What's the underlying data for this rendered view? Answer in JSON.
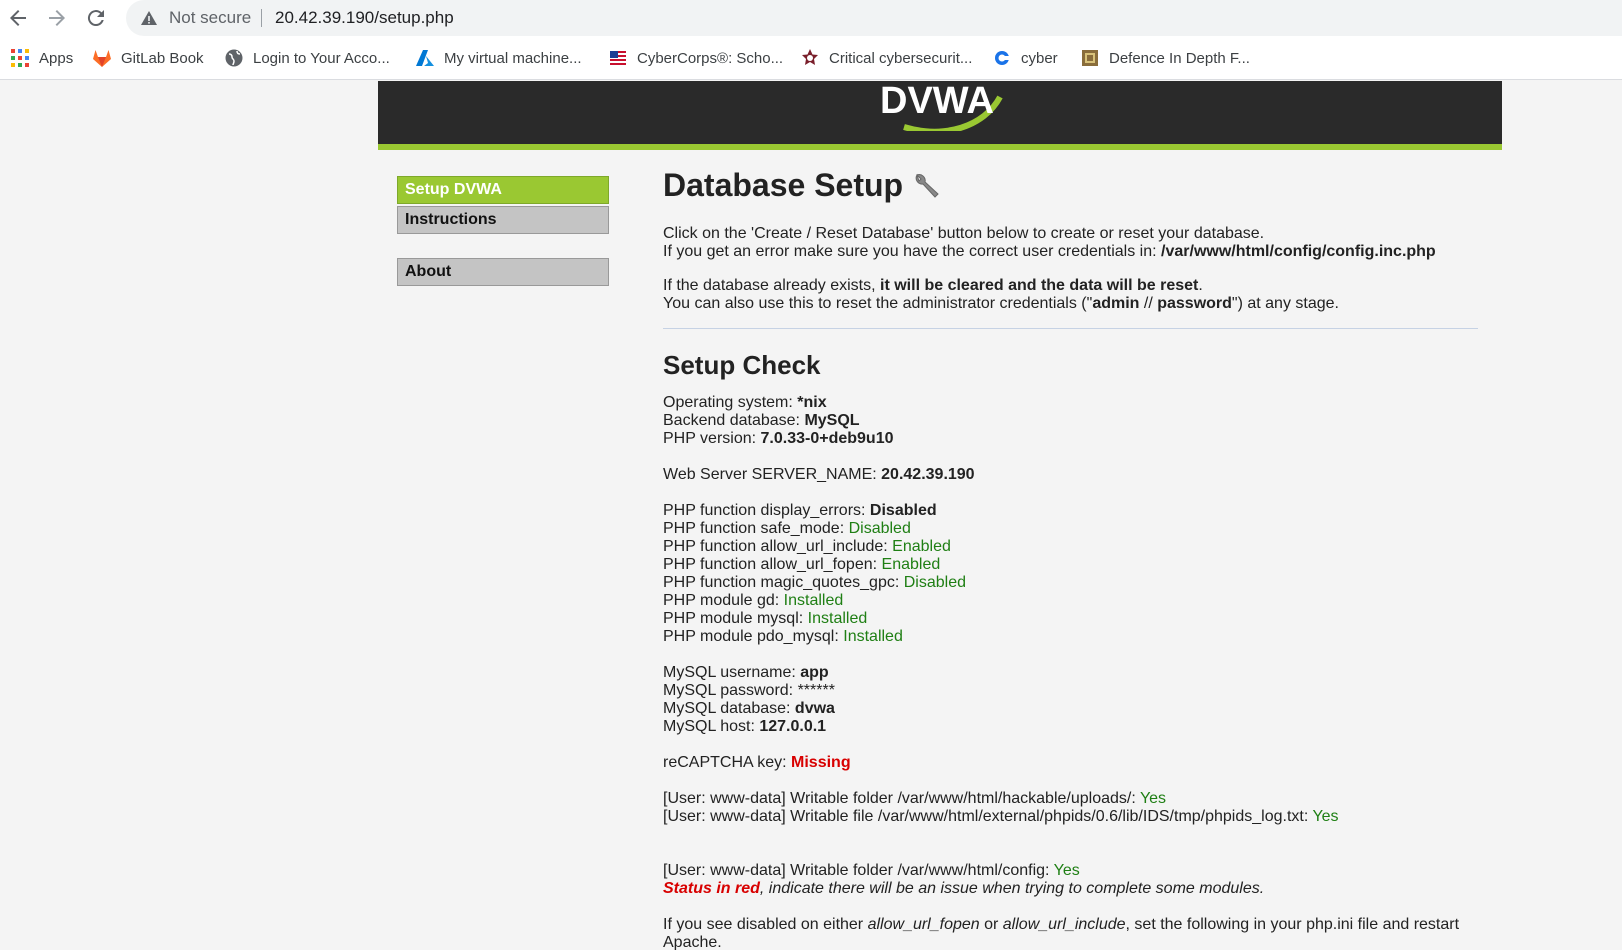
{
  "browser": {
    "security_label": "Not secure",
    "url": "20.42.39.190/setup.php"
  },
  "bookmarks": [
    {
      "label": "Apps",
      "icon": "apps-grid-icon"
    },
    {
      "label": "GitLab Book",
      "icon": "gitlab-icon"
    },
    {
      "label": "Login to Your Acco...",
      "icon": "globe-icon"
    },
    {
      "label": "My virtual machine...",
      "icon": "azure-icon"
    },
    {
      "label": "CyberCorps®: Scho...",
      "icon": "flag-icon"
    },
    {
      "label": "Critical cybersecurit...",
      "icon": "star-badge-icon"
    },
    {
      "label": "cyber",
      "icon": "cyber-icon"
    },
    {
      "label": "Defence In Depth F...",
      "icon": "doc-icon"
    }
  ],
  "logo_text": "DVWA",
  "menu": [
    {
      "label": "Setup DVWA",
      "active": true
    },
    {
      "label": "Instructions",
      "active": false
    },
    {
      "label": "About",
      "active": false
    }
  ],
  "main": {
    "title": "Database Setup",
    "intro1": "Click on the 'Create / Reset Database' button below to create or reset your database.",
    "intro2_a": "If you get an error make sure you have the correct user credentials in: ",
    "intro2_b": "/var/www/html/config/config.inc.php",
    "intro3_a": "If the database already exists, ",
    "intro3_b": "it will be cleared and the data will be reset",
    "intro3_c": ".",
    "intro4_a": "You can also use this to reset the administrator credentials (\"",
    "intro4_b": "admin",
    "intro4_c": " // ",
    "intro4_d": "password",
    "intro4_e": "\") at any stage.",
    "check_title": "Setup Check",
    "os_label": "Operating system: ",
    "os_value": "*nix",
    "db_label": "Backend database: ",
    "db_value": "MySQL",
    "php_label": "PHP version: ",
    "php_value": "7.0.33-0+deb9u10",
    "server_label": "Web Server SERVER_NAME: ",
    "server_value": "20.42.39.190",
    "display_errors_label": "PHP function display_errors: ",
    "display_errors_value": "Disabled",
    "safe_mode_label": "PHP function safe_mode: ",
    "safe_mode_value": "Disabled",
    "url_include_label": "PHP function allow_url_include: ",
    "url_include_value": "Enabled",
    "url_fopen_label": "PHP function allow_url_fopen: ",
    "url_fopen_value": "Enabled",
    "magic_quotes_label": "PHP function magic_quotes_gpc: ",
    "magic_quotes_value": "Disabled",
    "gd_label": "PHP module gd: ",
    "gd_value": "Installed",
    "mysql_label": "PHP module mysql: ",
    "mysql_value": "Installed",
    "pdo_label": "PHP module pdo_mysql: ",
    "pdo_value": "Installed",
    "mysql_user_label": "MySQL username: ",
    "mysql_user_value": "app",
    "mysql_pass_label": "MySQL password: ",
    "mysql_pass_value": "******",
    "mysql_db_label": "MySQL database: ",
    "mysql_db_value": "dvwa",
    "mysql_host_label": "MySQL host: ",
    "mysql_host_value": "127.0.0.1",
    "recaptcha_label": "reCAPTCHA key: ",
    "recaptcha_value": "Missing",
    "uploads_label": "[User: www-data] Writable folder /var/www/html/hackable/uploads/: ",
    "uploads_value": "Yes",
    "phpids_label": "[User: www-data] Writable file /var/www/html/external/phpids/0.6/lib/IDS/tmp/phpids_log.txt: ",
    "phpids_value": "Yes",
    "config_label": "[User: www-data] Writable folder /var/www/html/config: ",
    "config_value": "Yes",
    "status_red": "Status in red",
    "status_rest": ", indicate there will be an issue when trying to complete some modules.",
    "note_a": "If you see disabled on either ",
    "note_b": "allow_url_fopen",
    "note_c": " or ",
    "note_d": "allow_url_include",
    "note_e": ", set the following in your php.ini file and restart",
    "note_f": "Apache."
  }
}
